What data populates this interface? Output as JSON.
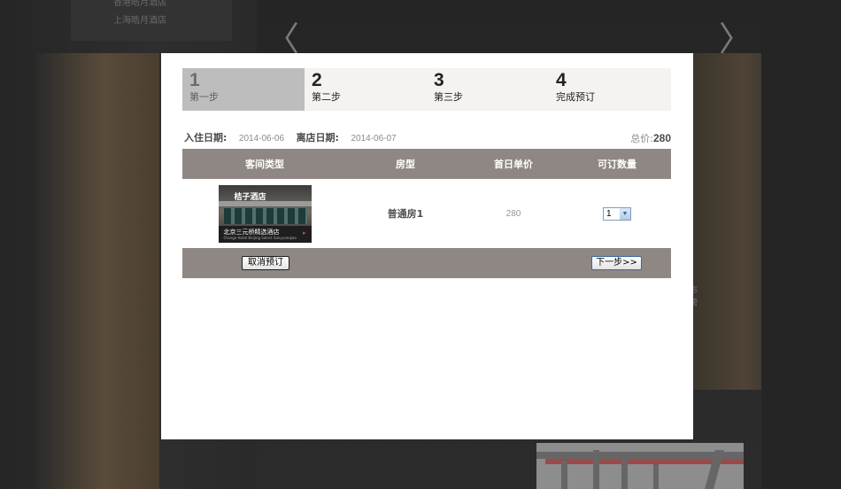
{
  "background": {
    "menu_items": [
      "香港晧月酒店",
      "上海晧月酒店"
    ],
    "side_text": [
      "市",
      "榜"
    ],
    "prev_glyph": "〈",
    "next_glyph": "〉"
  },
  "steps": [
    {
      "num": "1",
      "label": "第一步",
      "active": true
    },
    {
      "num": "2",
      "label": "第二步",
      "active": false
    },
    {
      "num": "3",
      "label": "第三步",
      "active": false
    },
    {
      "num": "4",
      "label": "完成预订",
      "active": false
    }
  ],
  "booking": {
    "checkin_label": "入住日期:",
    "checkin_value": "2014-06-06",
    "checkout_label": "离店日期:",
    "checkout_value": "2014-06-07",
    "total_label": "总价:",
    "total_value": "280"
  },
  "table": {
    "headers": [
      "客间类型",
      "房型",
      "首日单价",
      "可订数量"
    ],
    "rows": [
      {
        "image_caption": "北京三元桥精选酒店",
        "image_sign": "桔子酒店",
        "image_sub": "Orange Hotel Beijing Select Sanyuanqiao",
        "room_type": "普通房1",
        "price": "280",
        "quantity": "1"
      }
    ]
  },
  "buttons": {
    "cancel": "取消预订",
    "next": "下一步>>"
  },
  "colors": {
    "header_bg": "#8f8783",
    "active_step_bg": "#bdbdbd",
    "steps_bg": "#f5f2ef"
  }
}
